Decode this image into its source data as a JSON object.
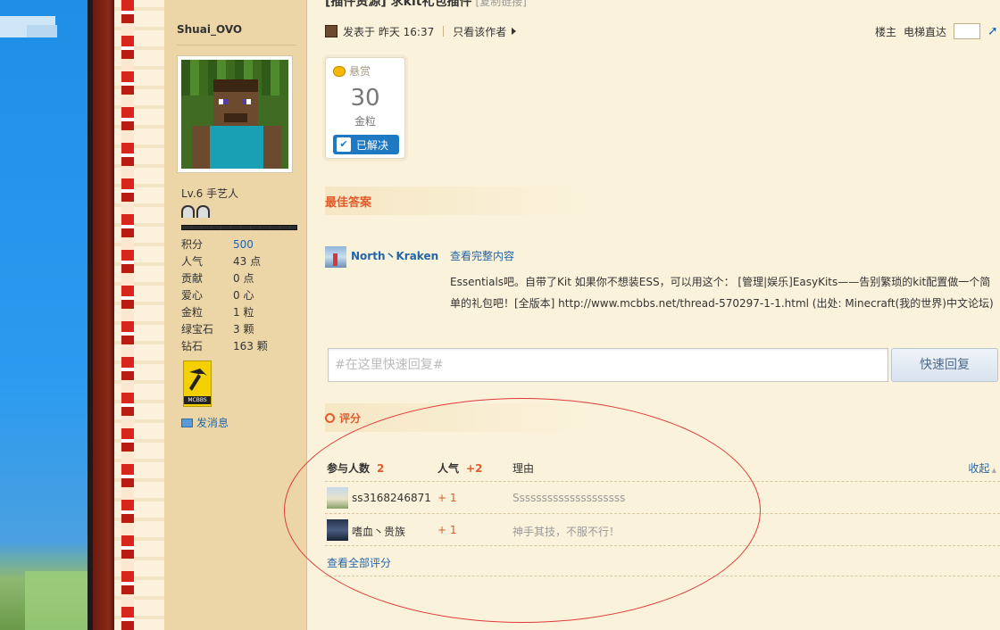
{
  "thread": {
    "title": "[插件资源] 求kit礼包插件",
    "title_aux": "[复制链接]"
  },
  "author": {
    "name": "Shuai_OVO",
    "level": "Lv.6 手艺人",
    "stats": [
      {
        "label": "积分",
        "value": "500"
      },
      {
        "label": "人气",
        "value": "43 点"
      },
      {
        "label": "贡献",
        "value": "0 点"
      },
      {
        "label": "爱心",
        "value": "0 心"
      },
      {
        "label": "金粒",
        "value": "1 粒"
      },
      {
        "label": "绿宝石",
        "value": "3 颗"
      },
      {
        "label": "钻石",
        "value": "163 颗"
      }
    ],
    "badge_label": "MCBBS",
    "send_message": "发消息"
  },
  "post_bar": {
    "posted": "发表于",
    "time": "昨天 16:37",
    "only_author": "只看该作者",
    "floor_label": "楼主",
    "jump_label": "电梯直达"
  },
  "bounty": {
    "label": "悬赏",
    "amount": "30",
    "unit": "金粒",
    "status": "已解决"
  },
  "best_answer": {
    "heading": "最佳答案",
    "author": "North丶Kraken",
    "view_full": "查看完整内容",
    "body": "Essentials吧。自带了Kit 如果你不想装ESS，可以用这个： [管理|娱乐]EasyKits——告别繁琐的kit配置做一个简单的礼包吧！[全版本] http://www.mcbbs.net/thread-570297-1-1.html (出处: Minecraft(我的世界)中文论坛)"
  },
  "quick_reply": {
    "placeholder": "#在这里快速回复#",
    "button": "快速回复"
  },
  "rating": {
    "heading": "评分",
    "participants_label": "参与人数",
    "participants_count": "2",
    "popularity_label": "人气",
    "popularity_total": "+2",
    "reason_label": "理由",
    "collapse": "收起",
    "rows": [
      {
        "user": "ss3168246871",
        "score": "+ 1",
        "reason": "Ssssssssssssssssssss"
      },
      {
        "user": "嗜血丶贵族",
        "score": "+ 1",
        "reason": "神手其技，不服不行！"
      }
    ],
    "view_all": "查看全部评分"
  },
  "colors": {
    "accent": "#e25b2b",
    "link": "#2366a8",
    "sidebar_bg": "#ecd6a8",
    "page_bg": "#fbf2db",
    "annotation": "#e03b3b"
  }
}
